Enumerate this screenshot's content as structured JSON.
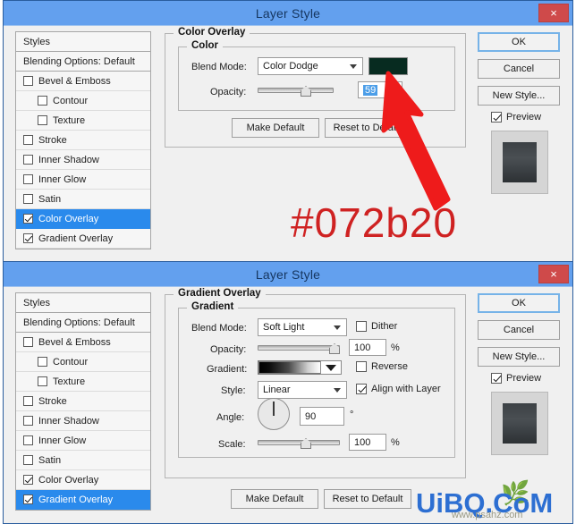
{
  "dialogs": [
    {
      "id": "color-overlay-dialog",
      "title": "Layer Style",
      "close_label": "×",
      "styles_panel": {
        "header": "Styles",
        "blending_options": "Blending Options: Default",
        "items": [
          {
            "label": "Bevel & Emboss",
            "checked": false,
            "sub": false,
            "selected": false
          },
          {
            "label": "Contour",
            "checked": false,
            "sub": true,
            "selected": false
          },
          {
            "label": "Texture",
            "checked": false,
            "sub": true,
            "selected": false
          },
          {
            "label": "Stroke",
            "checked": false,
            "sub": false,
            "selected": false
          },
          {
            "label": "Inner Shadow",
            "checked": false,
            "sub": false,
            "selected": false
          },
          {
            "label": "Inner Glow",
            "checked": false,
            "sub": false,
            "selected": false
          },
          {
            "label": "Satin",
            "checked": false,
            "sub": false,
            "selected": false
          },
          {
            "label": "Color Overlay",
            "checked": true,
            "sub": false,
            "selected": true
          },
          {
            "label": "Gradient Overlay",
            "checked": true,
            "sub": false,
            "selected": false
          }
        ]
      },
      "panel": {
        "legend": "Color Overlay",
        "inner_legend": "Color",
        "blend_mode_label": "Blend Mode:",
        "blend_mode_value": "Color Dodge",
        "color_swatch": "#072b20",
        "opacity_label": "Opacity:",
        "opacity_value": "59",
        "opacity_percent": 59
      },
      "buttons": {
        "make_default": "Make Default",
        "reset_to_default": "Reset to Default",
        "ok": "OK",
        "cancel": "Cancel",
        "new_style": "New Style...",
        "preview_label": "Preview",
        "preview_checked": true
      }
    },
    {
      "id": "gradient-overlay-dialog",
      "title": "Layer Style",
      "close_label": "×",
      "styles_panel": {
        "header": "Styles",
        "blending_options": "Blending Options: Default",
        "items": [
          {
            "label": "Bevel & Emboss",
            "checked": false,
            "sub": false,
            "selected": false
          },
          {
            "label": "Contour",
            "checked": false,
            "sub": true,
            "selected": false
          },
          {
            "label": "Texture",
            "checked": false,
            "sub": true,
            "selected": false
          },
          {
            "label": "Stroke",
            "checked": false,
            "sub": false,
            "selected": false
          },
          {
            "label": "Inner Shadow",
            "checked": false,
            "sub": false,
            "selected": false
          },
          {
            "label": "Inner Glow",
            "checked": false,
            "sub": false,
            "selected": false
          },
          {
            "label": "Satin",
            "checked": false,
            "sub": false,
            "selected": false
          },
          {
            "label": "Color Overlay",
            "checked": true,
            "sub": false,
            "selected": false
          },
          {
            "label": "Gradient Overlay",
            "checked": true,
            "sub": false,
            "selected": true
          }
        ]
      },
      "panel": {
        "legend": "Gradient Overlay",
        "inner_legend": "Gradient",
        "blend_mode_label": "Blend Mode:",
        "blend_mode_value": "Soft Light",
        "dither_label": "Dither",
        "dither_checked": false,
        "opacity_label": "Opacity:",
        "opacity_value": "100",
        "opacity_unit": "%",
        "opacity_percent": 100,
        "gradient_label": "Gradient:",
        "reverse_label": "Reverse",
        "reverse_checked": false,
        "style_label": "Style:",
        "style_value": "Linear",
        "align_label": "Align with Layer",
        "align_checked": true,
        "angle_label": "Angle:",
        "angle_value": "90",
        "angle_unit": "°",
        "scale_label": "Scale:",
        "scale_value": "100",
        "scale_unit": "%",
        "scale_percent": 100
      },
      "buttons": {
        "make_default": "Make Default",
        "reset_to_default": "Reset to Default",
        "ok": "OK",
        "cancel": "Cancel",
        "new_style": "New Style...",
        "preview_label": "Preview",
        "preview_checked": true
      }
    }
  ],
  "annotations": {
    "hex_callout": "#072b20",
    "hex_callout_color": "#cf2222",
    "arrow_color": "#ee1b1b"
  },
  "watermark": {
    "text": "UiBQ.CoM",
    "sub": "www.psahz.com",
    "color": "#2d6fd2"
  }
}
